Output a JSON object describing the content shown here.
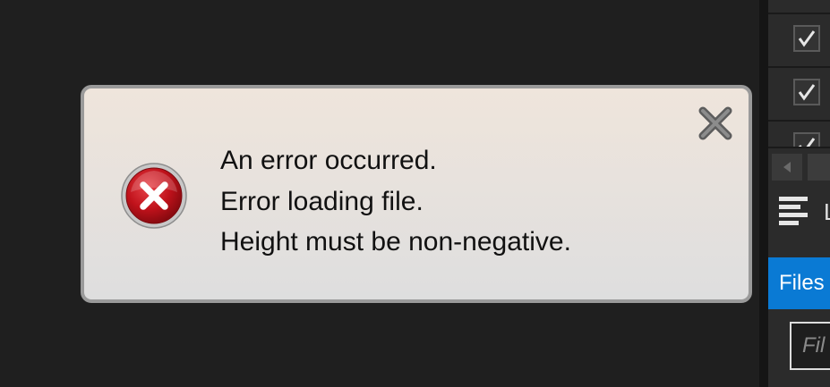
{
  "dialog": {
    "lines": [
      "An error occurred.",
      "Error loading file.",
      "Height must be non-negative."
    ],
    "icon": "error-icon",
    "close_icon": "close-icon"
  },
  "side_panel": {
    "checkboxes_checked": [
      true,
      true,
      true
    ],
    "list_section_label": "L",
    "files_tab_label": "Files",
    "filter_placeholder": "Fil"
  },
  "colors": {
    "background": "#1f1f1f",
    "panel": "#2b2b2b",
    "accent": "#0a7ad4",
    "error_red": "#c0121b"
  }
}
